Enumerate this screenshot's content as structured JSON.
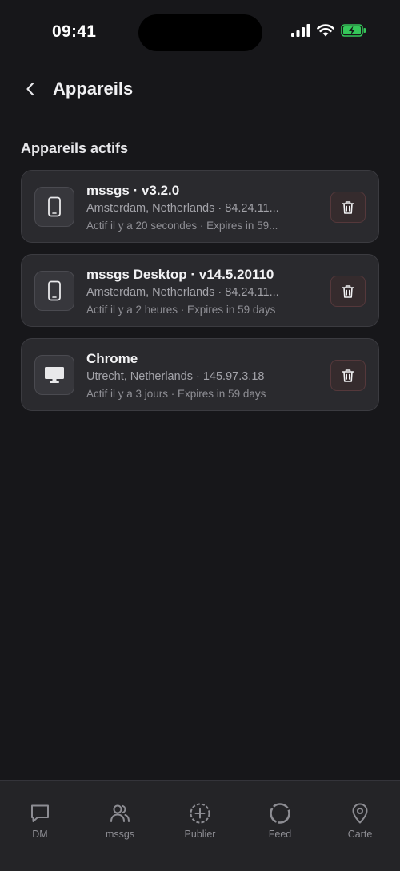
{
  "status_bar": {
    "time": "09:41"
  },
  "header": {
    "title": "Appareils",
    "back_icon": "chevron-left-icon"
  },
  "section": {
    "title": "Appareils actifs"
  },
  "devices": [
    {
      "name": "mssgs · v3.2.0",
      "location": "Amsterdam, Netherlands · 84.24.11...",
      "activity": "Actif il y a 20 secondes · Expires in 59...",
      "icon": "smartphone-icon"
    },
    {
      "name": "mssgs Desktop · v14.5.20110",
      "location": "Amsterdam, Netherlands · 84.24.11...",
      "activity": "Actif il y a 2 heures · Expires in 59 days",
      "icon": "smartphone-icon"
    },
    {
      "name": "Chrome",
      "location": "Utrecht, Netherlands · 145.97.3.18",
      "activity": "Actif il y a 3 jours · Expires in 59 days",
      "icon": "desktop-monitor-icon"
    }
  ],
  "tab_bar": {
    "items": [
      {
        "label": "DM",
        "icon": "chat-bubble-icon"
      },
      {
        "label": "mssgs",
        "icon": "users-icon"
      },
      {
        "label": "Publier",
        "icon": "add-circle-icon"
      },
      {
        "label": "Feed",
        "icon": "feed-circle-icon"
      },
      {
        "label": "Carte",
        "icon": "map-pin-icon"
      }
    ]
  },
  "colors": {
    "background": "#17171a",
    "card": "#2a2a2e",
    "delete_accent": "#e0706f",
    "battery_green": "#35c759"
  }
}
